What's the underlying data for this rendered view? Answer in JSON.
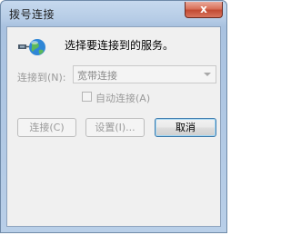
{
  "window": {
    "title": "拨号连接",
    "close_label": "x"
  },
  "prompt": "选择要连接到的服务。",
  "connect_to": {
    "label": "连接到(N):",
    "selected": "宽带连接"
  },
  "auto_connect": {
    "label": "自动连接(A)",
    "checked": false
  },
  "buttons": {
    "connect": "连接(C)",
    "settings": "设置(I)...",
    "cancel": "取消"
  },
  "icons": {
    "globe": "network-globe-icon",
    "dropdown": "chevron-down-icon"
  }
}
